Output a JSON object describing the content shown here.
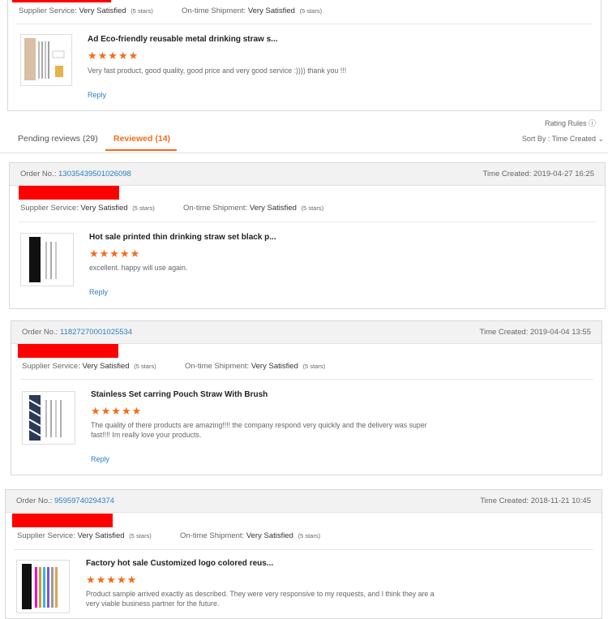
{
  "top_review": {
    "supplier_service_label": "Supplier Service:",
    "supplier_service_value": "Very Satisfied",
    "supplier_stars": "(5 stars)",
    "shipment_label": "On-time Shipment:",
    "shipment_value": "Very Satisfied",
    "shipment_stars": "(5 stars)",
    "product_title": "Ad Eco-friendly reusable metal drinking straw s...",
    "stars": "★★★★★",
    "review_text": "Very fast product, good quality, good price and very good service :)))) thank you !!!",
    "reply": "Reply"
  },
  "rating_rules": "Rating Rules ⓘ",
  "tabs": {
    "pending": "Pending reviews (29)",
    "reviewed": "Reviewed (14)"
  },
  "sort_by": "Sort By : Time Created ⌄",
  "orders": [
    {
      "order_label": "Order No.:",
      "order_no": "13035439501026098",
      "time": "Time Created: 2019-04-27 16:25",
      "supplier_service_label": "Supplier Service:",
      "supplier_service_value": "Very Satisfied",
      "supplier_stars": "(5 stars)",
      "shipment_label": "On-time Shipment:",
      "shipment_value": "Very Satisfied",
      "shipment_stars": "(5 stars)",
      "product_title": "Hot sale printed thin drinking straw set black p...",
      "stars": "★★★★★",
      "review_text": "excellent. happy  will use again.",
      "reply": "Reply"
    },
    {
      "order_label": "Order No.:",
      "order_no": "11827270001025534",
      "time": "Time Created: 2019-04-04 13:55",
      "supplier_service_label": "Supplier Service:",
      "supplier_service_value": "Very Satisfied",
      "supplier_stars": "(5 stars)",
      "shipment_label": "On-time Shipment:",
      "shipment_value": "Very Satisfied",
      "shipment_stars": "(5 stars)",
      "product_title": "Stainless Set carring Pouch Straw With Brush",
      "stars": "★★★★★",
      "review_text": "The quality of there products are amazing!!!! the company respond very quickly and the delivery was super fast!!!!  Im really love your products.",
      "reply": "Reply"
    },
    {
      "order_label": "Order No.:",
      "order_no": "95959740294374",
      "time": "Time Created: 2018-11-21 10:45",
      "supplier_service_label": "Supplier Service:",
      "supplier_service_value": "Very Satisfied",
      "supplier_stars": "(5 stars)",
      "shipment_label": "On-time Shipment:",
      "shipment_value": "Very Satisfied",
      "shipment_stars": "(5 stars)",
      "product_title": "Factory hot sale Customized logo colored reus...",
      "stars": "★★★★★",
      "review_text": "Product sample arrived exactly as described. They were very responsive to my requests, and I think they are a very viable business partner for the future.",
      "reply": "Reply"
    }
  ]
}
